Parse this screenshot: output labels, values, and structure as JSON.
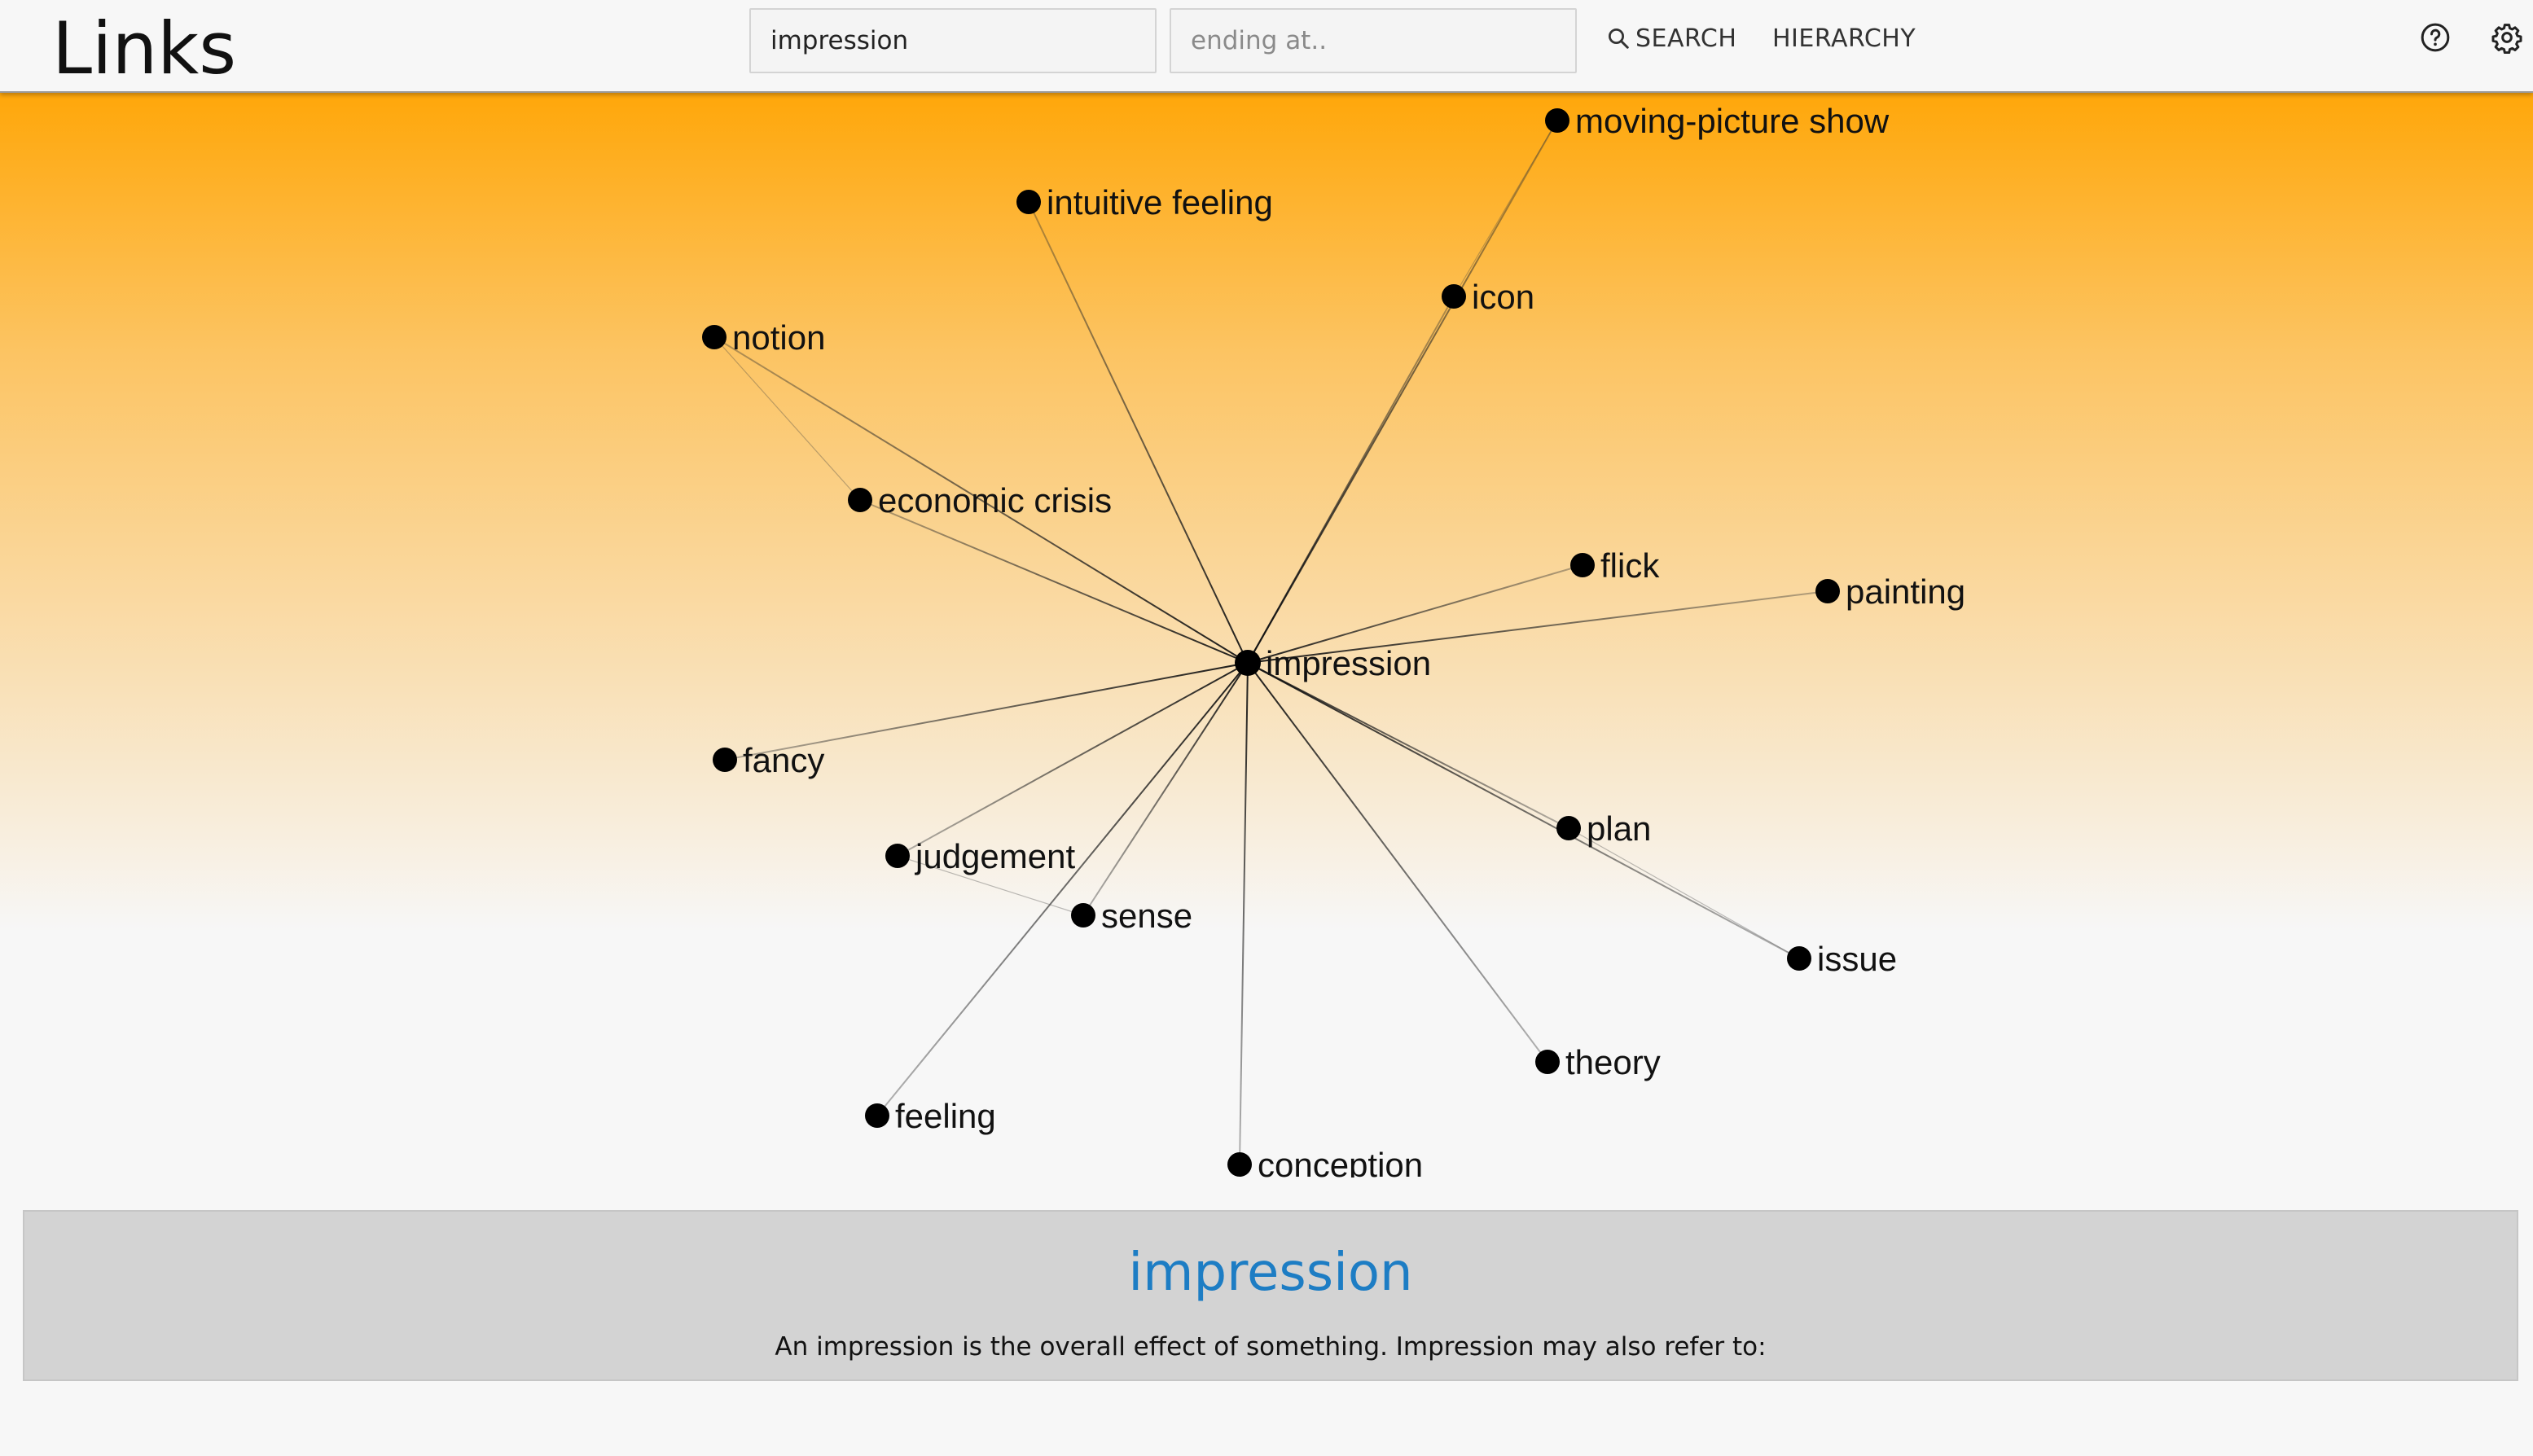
{
  "app": {
    "title": "Links"
  },
  "search": {
    "query_value": "impression",
    "end_placeholder": "ending at..",
    "search_label": "SEARCH",
    "hierarchy_label": "HIERARCHY"
  },
  "icons": {
    "search": "search-icon",
    "help": "help-icon",
    "settings": "gear-icon"
  },
  "colors": {
    "gradient_top": "#ffa70a",
    "background": "#f7f7f7",
    "node": "#000000",
    "info_title": "#1d7dc4",
    "info_panel": "#d3d3d3"
  },
  "graph": {
    "center": "impression",
    "nodes": [
      "moving-picture show",
      "intuitive feeling",
      "icon",
      "notion",
      "economic crisis",
      "flick",
      "painting",
      "fancy",
      "judgement",
      "sense",
      "plan",
      "issue",
      "theory",
      "feeling",
      "conception"
    ]
  },
  "info": {
    "title": "impression",
    "description": "An impression is the overall effect of something. Impression may also refer to:"
  }
}
